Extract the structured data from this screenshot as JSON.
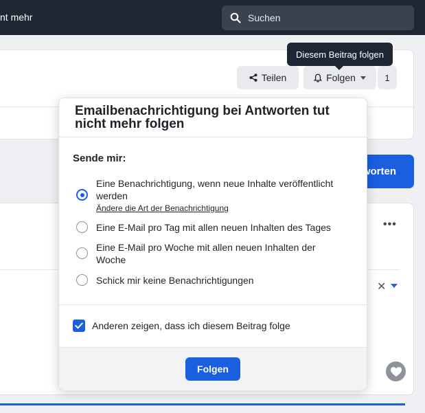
{
  "nav": {
    "partial_text": "nt mehr",
    "search_placeholder": "Suchen"
  },
  "post": {
    "share_label": "Teilen",
    "follow_label": "Folgen",
    "follow_count": "1",
    "tooltip": "Diesem Beitrag folgen",
    "reply_partial": "worten"
  },
  "popup": {
    "title": "Emailbenachrichtigung bei Antworten tut nicht mehr folgen",
    "send_label": "Sende mir:",
    "options": [
      {
        "label": "Eine Benachrichtigung, wenn neue Inhalte veröffentlicht werden",
        "selected": true,
        "link": "Ändere die Art der Benachrichtigung"
      },
      {
        "label": "Eine E-Mail pro Tag mit allen neuen Inhalten des Tages",
        "selected": false
      },
      {
        "label": "Eine E-Mail pro Woche mit allen neuen Inhalten der Woche",
        "selected": false
      },
      {
        "label": "Schick mir keine Benachrichtigungen",
        "selected": false
      }
    ],
    "show_following_label": "Anderen zeigen, dass ich diesem Beitrag folge",
    "show_following_checked": true,
    "submit_label": "Folgen"
  },
  "colors": {
    "accent": "#1a5fe0",
    "nav_bg": "#1f2633"
  }
}
